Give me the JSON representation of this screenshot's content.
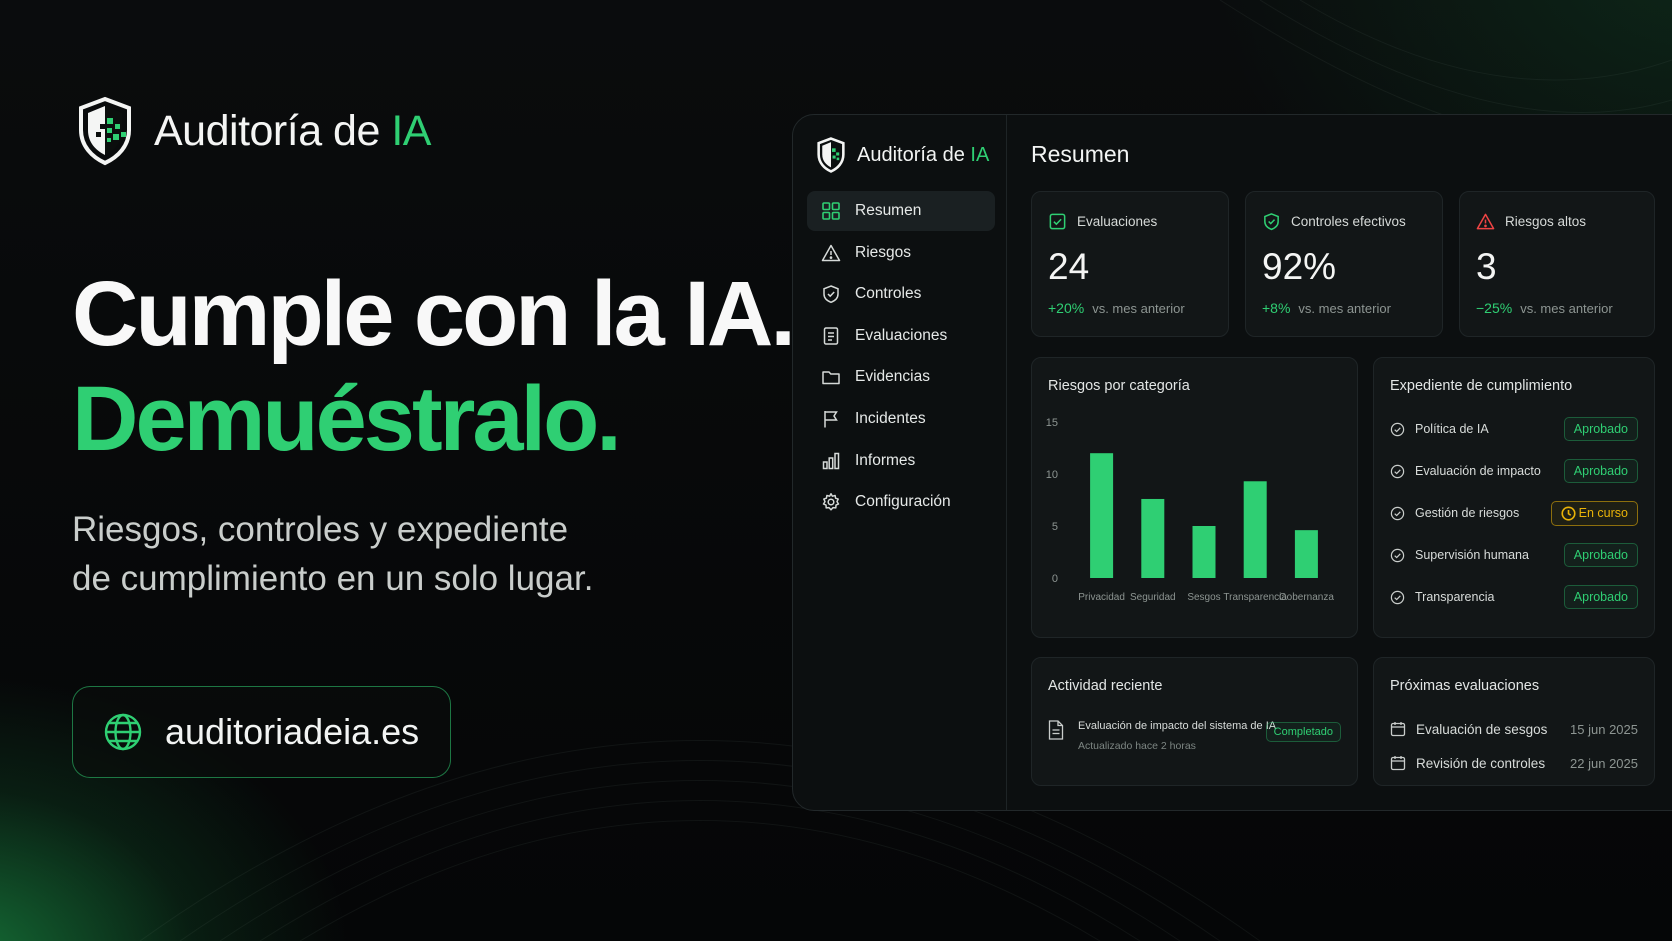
{
  "brand": {
    "name_prefix": "Auditoría de ",
    "name_accent": "IA"
  },
  "hero": {
    "title_line1": "Cumple con la IA.",
    "title_line2": "Demuéstralo.",
    "subtitle_line1": "Riesgos, controles y expediente",
    "subtitle_line2": "de cumplimiento en un solo lugar.",
    "url": "auditoriadeia.es"
  },
  "sidebar": {
    "items": [
      {
        "label": "Resumen",
        "icon": "grid-icon",
        "active": true
      },
      {
        "label": "Riesgos",
        "icon": "warning-icon"
      },
      {
        "label": "Controles",
        "icon": "shield-check-icon"
      },
      {
        "label": "Evaluaciones",
        "icon": "document-icon"
      },
      {
        "label": "Evidencias",
        "icon": "folder-icon"
      },
      {
        "label": "Incidentes",
        "icon": "flag-icon"
      },
      {
        "label": "Informes",
        "icon": "bar-chart-icon"
      },
      {
        "label": "Configuración",
        "icon": "gear-icon"
      }
    ]
  },
  "main": {
    "title": "Resumen",
    "kpis": [
      {
        "label": "Evaluaciones",
        "value": "24",
        "delta": "+20%",
        "delta_note": "vs. mes anterior",
        "icon": "checkbox-icon"
      },
      {
        "label": "Controles efectivos",
        "value": "92%",
        "delta": "+8%",
        "delta_note": "vs. mes anterior",
        "icon": "shield-check-icon"
      },
      {
        "label": "Riesgos altos",
        "value": "3",
        "delta": "−25%",
        "delta_note": "vs. mes anterior",
        "icon": "alert-triangle-icon"
      }
    ],
    "risk_chart": {
      "title": "Riesgos por categoría"
    },
    "expediente": {
      "title": "Expediente de cumplimiento",
      "items": [
        {
          "label": "Política de IA",
          "status": "Aprobado"
        },
        {
          "label": "Evaluación de impacto",
          "status": "Aprobado"
        },
        {
          "label": "Gestión de riesgos",
          "status": "En curso"
        },
        {
          "label": "Supervisión humana",
          "status": "Aprobado"
        },
        {
          "label": "Transparencia",
          "status": "Aprobado"
        }
      ]
    },
    "actividad": {
      "title": "Actividad reciente",
      "item_title": "Evaluación de impacto del sistema de IA",
      "item_time": "Actualizado hace 2 horas",
      "item_status": "Completado"
    },
    "proximas": {
      "title": "Próximas evaluaciones",
      "items": [
        {
          "label": "Evaluación de sesgos",
          "date": "15 jun 2025"
        },
        {
          "label": "Revisión de controles",
          "date": "22 jun 2025"
        }
      ]
    }
  },
  "colors": {
    "accent": "#2fcf73",
    "warning": "#eab308",
    "alert": "#ef4444",
    "background": "#07090a"
  },
  "chart_data": {
    "type": "bar",
    "title": "Riesgos por categoría",
    "categories": [
      "Privacidad",
      "Seguridad",
      "Sesgos",
      "Transparencia",
      "Gobernanza"
    ],
    "values": [
      12,
      7.6,
      5,
      9.3,
      4.6
    ],
    "yticks": [
      0,
      5,
      10,
      15
    ],
    "ylim": [
      0,
      15
    ],
    "grid": false,
    "legend": "none"
  }
}
